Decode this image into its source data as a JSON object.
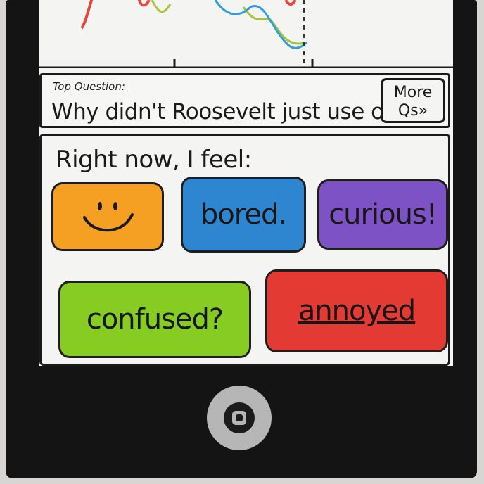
{
  "chart": {
    "colors": {
      "red": "#e4483e",
      "green": "#a8c43a",
      "blue": "#2f9fdc"
    }
  },
  "question": {
    "label": "Top Question:",
    "text": "Why didn't Roosevelt just use on",
    "more_line1": "More",
    "more_line2": "Qs»"
  },
  "feel": {
    "prompt": "Right now, I feel:",
    "moods": [
      {
        "label": "",
        "icon": "smiley-face-icon",
        "color": "#f5a022"
      },
      {
        "label": "bored.",
        "color": "#2f86d0"
      },
      {
        "label": "curious!",
        "color": "#7c52c4"
      },
      {
        "label": "confused?",
        "color": "#86cc22"
      },
      {
        "label": "annoyed",
        "color": "#e33a33"
      }
    ]
  },
  "home_button": {
    "icon": "home-button-icon"
  }
}
